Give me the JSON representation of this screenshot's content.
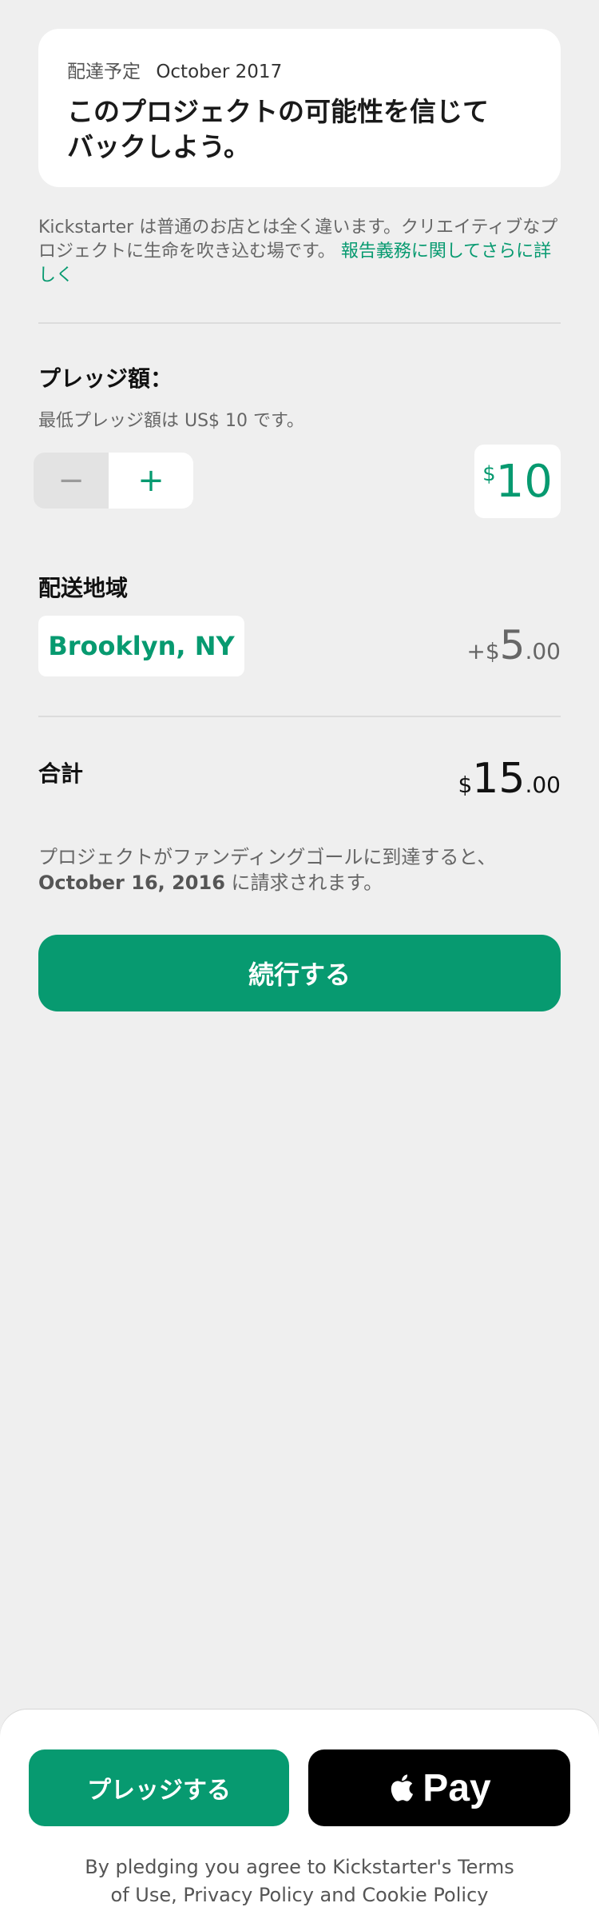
{
  "card": {
    "delivery_label": "配達予定",
    "delivery_date": "October 2017",
    "title_line1": "このプロジェクトの可能性を信じて",
    "title_line2": "バックしよう。"
  },
  "intro": {
    "text": "Kickstarter は普通のお店とは全く違います。クリエイティブなプロジェクトに生命を吹き込む場です。",
    "link": "報告義務に関してさらに詳しく"
  },
  "pledge": {
    "label": "プレッジ額：",
    "min_text": "最低プレッジ額は US$ 10 です。",
    "minus": "−",
    "plus": "+",
    "currency": "$",
    "amount": "10"
  },
  "shipping": {
    "label": "配送地域",
    "location": "Brooklyn, NY",
    "price_prefix": "+$",
    "price_main": "5",
    "price_cents": ".00"
  },
  "total": {
    "label": "合計",
    "currency": "$",
    "price_main": "15",
    "price_cents": ".00"
  },
  "charge": {
    "line1": "プロジェクトがファンディングゴールに到達すると、",
    "date": "October 16, 2016",
    "line2_suffix": " に請求されます。"
  },
  "continue_label": "続行する",
  "bottom": {
    "pledge_label": "プレッジする",
    "apple_pay_label": "Pay",
    "terms_line1": "By pledging you agree to Kickstarter's Terms",
    "terms_line2": "of Use, Privacy Policy and Cookie Policy"
  },
  "colors": {
    "accent": "#079a70",
    "background": "#efefef",
    "card": "#ffffff"
  }
}
